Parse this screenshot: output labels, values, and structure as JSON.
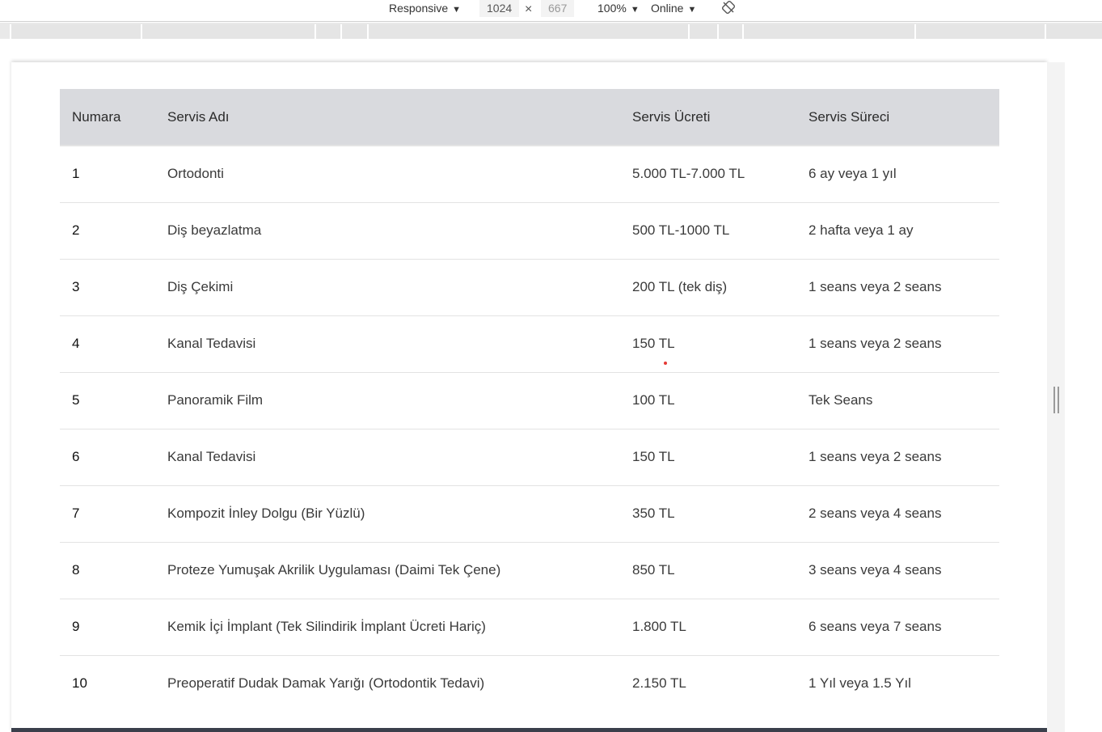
{
  "devtools": {
    "device": "Responsive",
    "width": "1024",
    "times": "×",
    "height": "667",
    "zoom": "100%",
    "network": "Online"
  },
  "table": {
    "headers": {
      "number": "Numara",
      "name": "Servis Adı",
      "fee": "Servis Ücreti",
      "duration": "Servis Süreci"
    },
    "rows": [
      {
        "number": "1",
        "name": "Ortodonti",
        "fee": "5.000 TL-7.000 TL",
        "duration": "6 ay veya 1 yıl"
      },
      {
        "number": "2",
        "name": "Diş beyazlatma",
        "fee": "500 TL-1000 TL",
        "duration": "2 hafta veya 1 ay"
      },
      {
        "number": "3",
        "name": "Diş Çekimi",
        "fee": "200 TL (tek diş)",
        "duration": "1 seans veya 2 seans"
      },
      {
        "number": "4",
        "name": "Kanal Tedavisi",
        "fee": "150 TL",
        "duration": "1 seans veya 2 seans"
      },
      {
        "number": "5",
        "name": "Panoramik Film",
        "fee": "100 TL",
        "duration": "Tek Seans"
      },
      {
        "number": "6",
        "name": "Kanal Tedavisi",
        "fee": "150 TL",
        "duration": "1 seans veya 2 seans"
      },
      {
        "number": "7",
        "name": "Kompozit İnley Dolgu (Bir Yüzlü)",
        "fee": "350 TL",
        "duration": "2 seans veya 4 seans"
      },
      {
        "number": "8",
        "name": "Proteze Yumuşak Akrilik Uygulaması (Daimi Tek Çene)",
        "fee": "850 TL",
        "duration": "3 seans veya 4 seans"
      },
      {
        "number": "9",
        "name": "Kemik İçi İmplant (Tek Silindirik İmplant Ücreti Hariç)",
        "fee": "1.800 TL",
        "duration": "6 seans veya 7 seans"
      },
      {
        "number": "10",
        "name": "Preoperatif Dudak Damak Yarığı (Ortodontik Tedavi)",
        "fee": "2.150 TL",
        "duration": "1 Yıl veya 1.5 Yıl"
      }
    ]
  }
}
